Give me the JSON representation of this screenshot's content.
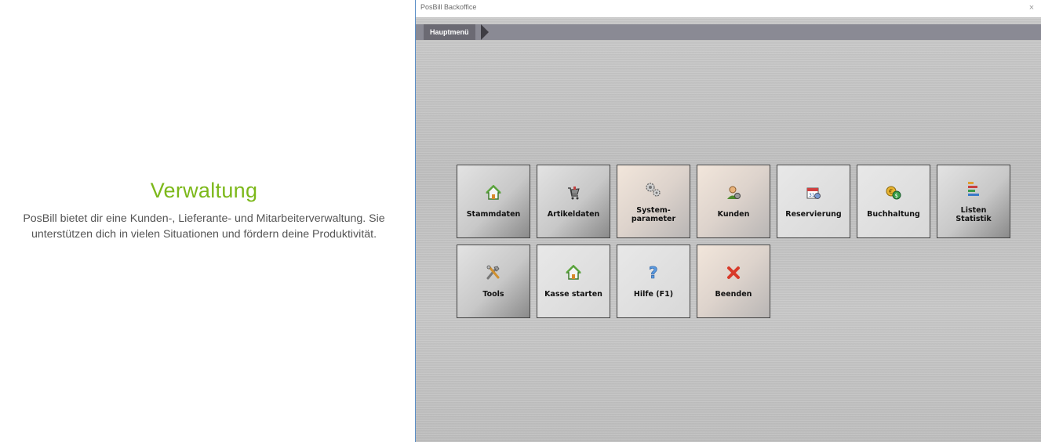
{
  "promo": {
    "title": "Verwaltung",
    "text": "PosBill bietet dir eine Kunden-, Lieferante- und Mitarbeiterverwaltung. Sie unterstützen dich in vielen Situationen und fördern deine Produktivität."
  },
  "window": {
    "title": "PosBill Backoffice",
    "close_icon": "×",
    "breadcrumb": "Hauptmenü"
  },
  "tiles": [
    {
      "label": "Stammdaten",
      "icon": "home-icon"
    },
    {
      "label": "Artikeldaten",
      "icon": "cart-icon"
    },
    {
      "label_line1": "System-",
      "label_line2": "parameter",
      "icon": "gears-icon"
    },
    {
      "label": "Kunden",
      "icon": "customer-icon"
    },
    {
      "label": "Reservierung",
      "icon": "calendar-icon"
    },
    {
      "label": "Buchhaltung",
      "icon": "coins-icon"
    },
    {
      "label_line1": "Listen",
      "label_line2": "Statistik",
      "icon": "bars-icon"
    },
    {
      "label": "Tools",
      "icon": "tools-icon"
    },
    {
      "label": "Kasse starten",
      "icon": "home-icon"
    },
    {
      "label": "Hilfe (F1)",
      "icon": "help-icon"
    },
    {
      "label": "Beenden",
      "icon": "close-x-icon"
    }
  ],
  "colors": {
    "promo_title": "#7cb81a",
    "nav_bar": "#8a8a94",
    "crumb": "#6b6a73"
  }
}
